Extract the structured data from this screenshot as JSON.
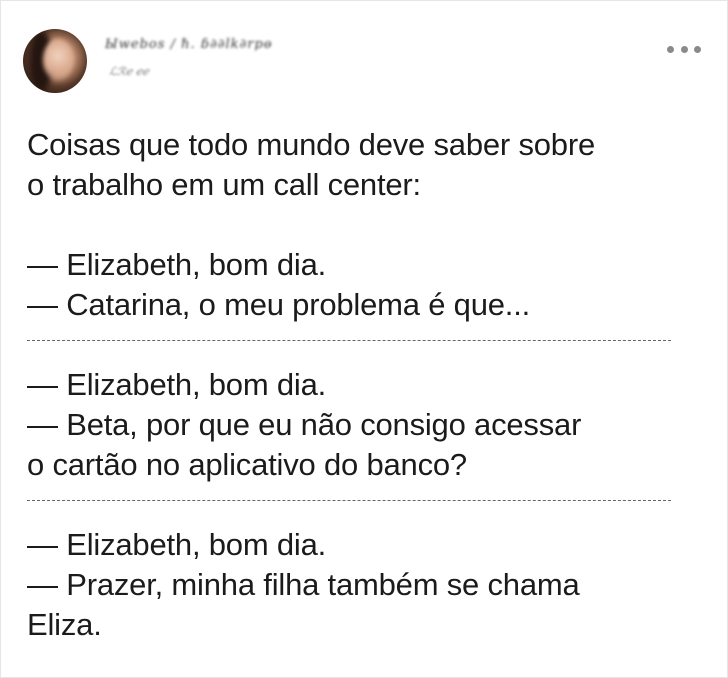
{
  "post": {
    "author_name": "Ыwebos ∕ ℏ. ɓ∂∂lk∂rpɵ",
    "author_handle": "ℒℛℯ ℯℯ",
    "more_icon": "more-horizontal-icon",
    "lines": [
      "Coisas que todo mundo deve saber sobre",
      "o trabalho em um call center:",
      "— Elizabeth, bom dia.",
      "— Catarina, o meu problema é que...",
      "— Elizabeth, bom dia.",
      "— Beta, por que eu não consigo acessar",
      "o cartão no aplicativo do banco?",
      "— Elizabeth, bom dia.",
      "— Prazer, minha filha também se chama",
      "Eliza."
    ]
  }
}
